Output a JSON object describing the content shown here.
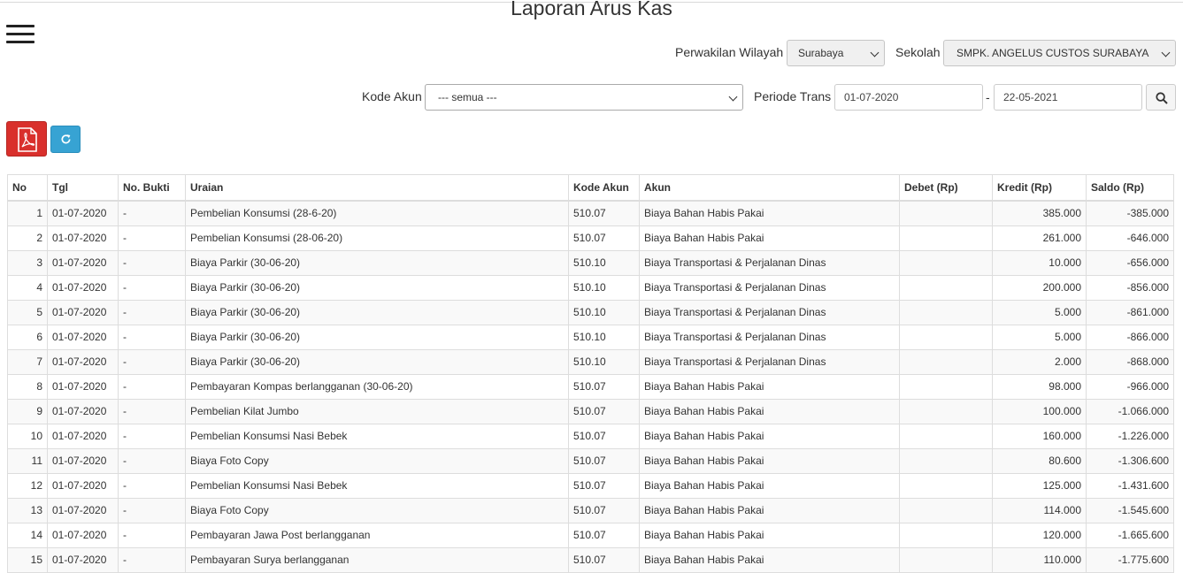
{
  "page": {
    "title": "Laporan Arus Kas"
  },
  "filters": {
    "region_label": "Perwakilan Wilayah",
    "region_value": "Surabaya",
    "school_label": "Sekolah",
    "school_value": "SMPK. ANGELUS CUSTOS SURABAYA",
    "account_label": "Kode Akun",
    "account_value": "--- semua ---",
    "period_label": "Periode Trans",
    "date_from": "01-07-2020",
    "date_separator": "-",
    "date_to": "22-05-2021"
  },
  "icons": {
    "menu": "hamburger-menu-icon",
    "search": "search-icon",
    "pdf": "pdf-icon",
    "refresh": "refresh-icon"
  },
  "colors": {
    "pdf_button": "#d9302c",
    "refresh_button": "#37a3d3"
  },
  "table": {
    "headers": {
      "no": "No",
      "tgl": "Tgl",
      "bukti": "No. Bukti",
      "uraian": "Uraian",
      "kode": "Kode Akun",
      "akun": "Akun",
      "debet": "Debet (Rp)",
      "kredit": "Kredit (Rp)",
      "saldo": "Saldo (Rp)"
    },
    "rows": [
      {
        "no": "1",
        "tgl": "01-07-2020",
        "bukti": "-",
        "uraian": "Pembelian Konsumsi (28-6-20)",
        "kode": "510.07",
        "akun": "Biaya Bahan Habis Pakai",
        "debet": "",
        "kredit": "385.000",
        "saldo": "-385.000"
      },
      {
        "no": "2",
        "tgl": "01-07-2020",
        "bukti": "-",
        "uraian": "Pembelian Konsumsi (28-06-20)",
        "kode": "510.07",
        "akun": "Biaya Bahan Habis Pakai",
        "debet": "",
        "kredit": "261.000",
        "saldo": "-646.000"
      },
      {
        "no": "3",
        "tgl": "01-07-2020",
        "bukti": "-",
        "uraian": "Biaya Parkir (30-06-20)",
        "kode": "510.10",
        "akun": "Biaya Transportasi & Perjalanan Dinas",
        "debet": "",
        "kredit": "10.000",
        "saldo": "-656.000"
      },
      {
        "no": "4",
        "tgl": "01-07-2020",
        "bukti": "-",
        "uraian": "Biaya Parkir (30-06-20)",
        "kode": "510.10",
        "akun": "Biaya Transportasi & Perjalanan Dinas",
        "debet": "",
        "kredit": "200.000",
        "saldo": "-856.000"
      },
      {
        "no": "5",
        "tgl": "01-07-2020",
        "bukti": "-",
        "uraian": "Biaya Parkir (30-06-20)",
        "kode": "510.10",
        "akun": "Biaya Transportasi & Perjalanan Dinas",
        "debet": "",
        "kredit": "5.000",
        "saldo": "-861.000"
      },
      {
        "no": "6",
        "tgl": "01-07-2020",
        "bukti": "-",
        "uraian": "Biaya Parkir (30-06-20)",
        "kode": "510.10",
        "akun": "Biaya Transportasi & Perjalanan Dinas",
        "debet": "",
        "kredit": "5.000",
        "saldo": "-866.000"
      },
      {
        "no": "7",
        "tgl": "01-07-2020",
        "bukti": "-",
        "uraian": "Biaya Parkir (30-06-20)",
        "kode": "510.10",
        "akun": "Biaya Transportasi & Perjalanan Dinas",
        "debet": "",
        "kredit": "2.000",
        "saldo": "-868.000"
      },
      {
        "no": "8",
        "tgl": "01-07-2020",
        "bukti": "-",
        "uraian": "Pembayaran Kompas berlangganan (30-06-20)",
        "kode": "510.07",
        "akun": "Biaya Bahan Habis Pakai",
        "debet": "",
        "kredit": "98.000",
        "saldo": "-966.000"
      },
      {
        "no": "9",
        "tgl": "01-07-2020",
        "bukti": "-",
        "uraian": "Pembelian Kilat Jumbo",
        "kode": "510.07",
        "akun": "Biaya Bahan Habis Pakai",
        "debet": "",
        "kredit": "100.000",
        "saldo": "-1.066.000"
      },
      {
        "no": "10",
        "tgl": "01-07-2020",
        "bukti": "-",
        "uraian": "Pembelian Konsumsi Nasi Bebek",
        "kode": "510.07",
        "akun": "Biaya Bahan Habis Pakai",
        "debet": "",
        "kredit": "160.000",
        "saldo": "-1.226.000"
      },
      {
        "no": "11",
        "tgl": "01-07-2020",
        "bukti": "-",
        "uraian": "Biaya Foto Copy",
        "kode": "510.07",
        "akun": "Biaya Bahan Habis Pakai",
        "debet": "",
        "kredit": "80.600",
        "saldo": "-1.306.600"
      },
      {
        "no": "12",
        "tgl": "01-07-2020",
        "bukti": "-",
        "uraian": "Pembelian Konsumsi Nasi Bebek",
        "kode": "510.07",
        "akun": "Biaya Bahan Habis Pakai",
        "debet": "",
        "kredit": "125.000",
        "saldo": "-1.431.600"
      },
      {
        "no": "13",
        "tgl": "01-07-2020",
        "bukti": "-",
        "uraian": "Biaya Foto Copy",
        "kode": "510.07",
        "akun": "Biaya Bahan Habis Pakai",
        "debet": "",
        "kredit": "114.000",
        "saldo": "-1.545.600"
      },
      {
        "no": "14",
        "tgl": "01-07-2020",
        "bukti": "-",
        "uraian": "Pembayaran Jawa Post berlangganan",
        "kode": "510.07",
        "akun": "Biaya Bahan Habis Pakai",
        "debet": "",
        "kredit": "120.000",
        "saldo": "-1.665.600"
      },
      {
        "no": "15",
        "tgl": "01-07-2020",
        "bukti": "-",
        "uraian": "Pembayaran Surya berlangganan",
        "kode": "510.07",
        "akun": "Biaya Bahan Habis Pakai",
        "debet": "",
        "kredit": "110.000",
        "saldo": "-1.775.600"
      }
    ]
  }
}
